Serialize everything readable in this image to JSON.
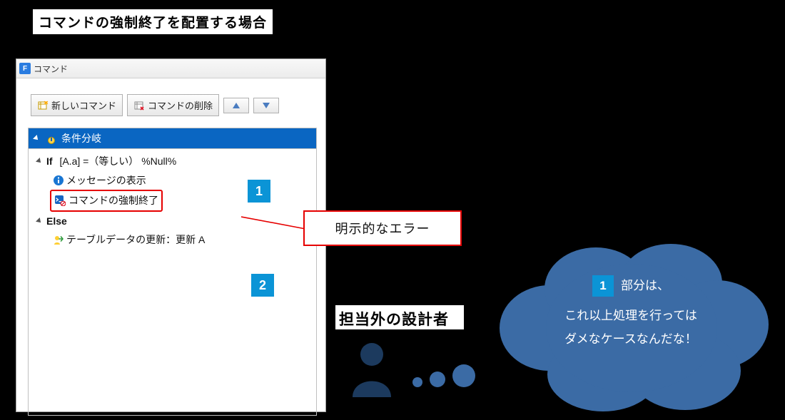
{
  "title": "コマンドの強制終了を配置する場合",
  "window": {
    "title_icon_letter": "F",
    "title": "コマンド",
    "toolbar": {
      "new_command": "新しいコマンド",
      "delete_command": "コマンドの削除"
    },
    "tree": {
      "root_label": "条件分岐",
      "if_label_prefix": "If",
      "if_condition": "[A.a] =（等しい）  %Null%",
      "msg_display": "メッセージの表示",
      "force_stop": "コマンドの強制終了",
      "else_label": "Else",
      "update_row": "テーブルデータの更新：更新 A"
    }
  },
  "badges": {
    "one": "1",
    "two": "2"
  },
  "callout": "明示的なエラー",
  "designer_label": "担当外の設計者",
  "cloud": {
    "badge": "1",
    "line1_suffix": "部分は、",
    "line2": "これ以上処理を行っては",
    "line3": "ダメなケースなんだな！"
  }
}
